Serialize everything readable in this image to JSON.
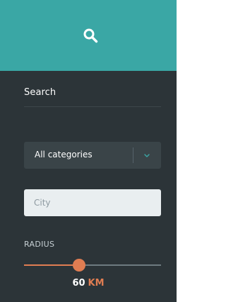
{
  "header": {
    "icon": "search-icon",
    "background": "#3aa7a5"
  },
  "search": {
    "title": "Search"
  },
  "category_select": {
    "selected": "All categories",
    "icon": "chevron-down-icon"
  },
  "city": {
    "placeholder": "City",
    "value": ""
  },
  "radius": {
    "label": "RADIUS",
    "value": "60",
    "unit": "KM",
    "fraction": 0.4
  },
  "colors": {
    "panel": "#2c3438",
    "accent": "#e07d52",
    "teal": "#3aa7a5"
  }
}
